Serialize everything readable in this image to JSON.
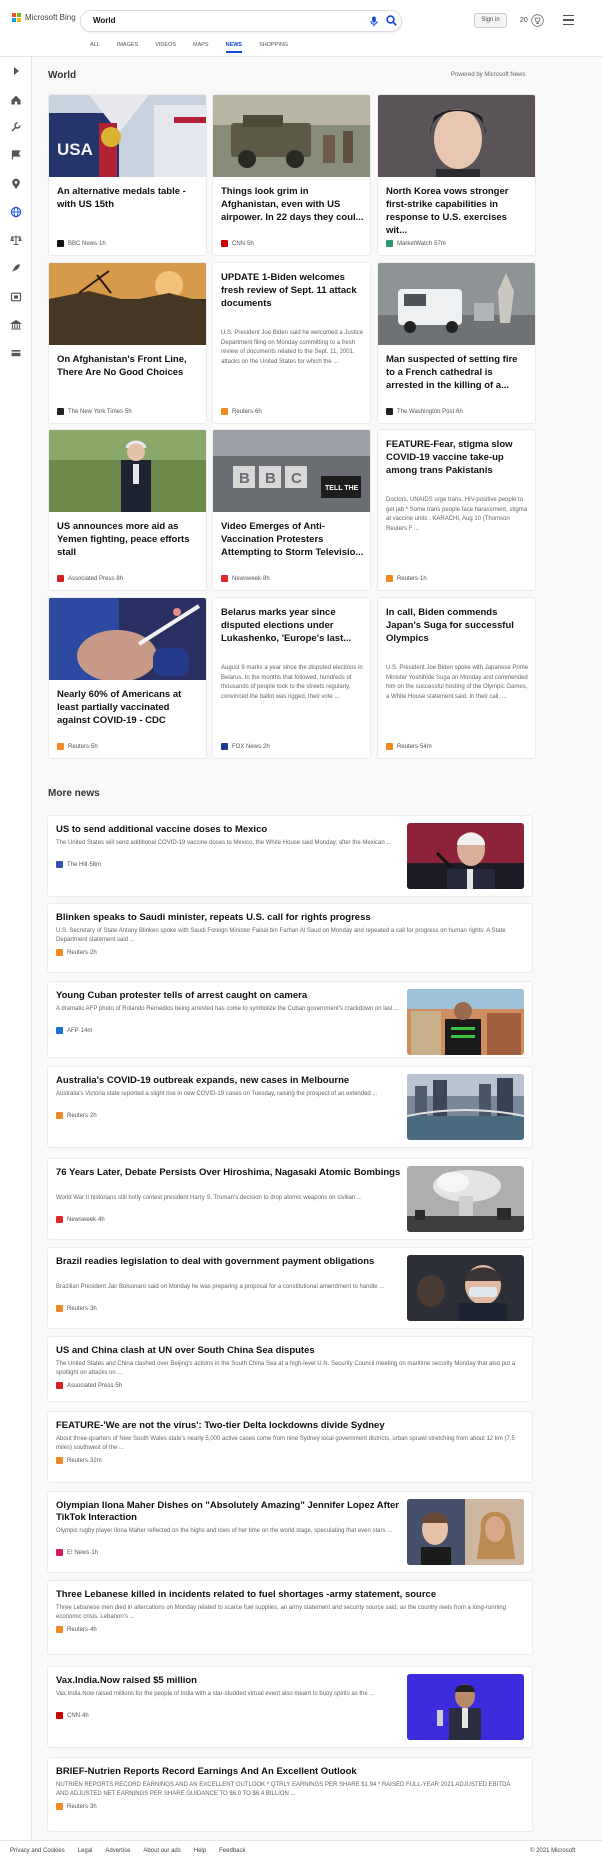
{
  "header": {
    "logo_text": "Microsoft Bing",
    "search_value": "World",
    "sign_in": "Sign in",
    "rewards_count": "20"
  },
  "tabs": [
    "ALL",
    "IMAGES",
    "VIDEOS",
    "MAPS",
    "NEWS",
    "SHOPPING"
  ],
  "active_tab": "NEWS",
  "section": {
    "title": "World",
    "powered": "Powered by Microsoft News"
  },
  "cards": [
    {
      "title": "An alternative medals table - with US 15th",
      "desc": "",
      "source": "BBC News",
      "time": "1h",
      "logo_color": "#111",
      "image": true,
      "img": "medal"
    },
    {
      "title": "Things look grim in Afghanistan, even with US airpower. In 22 days they coul...",
      "desc": "",
      "source": "CNN",
      "time": "5h",
      "logo_color": "#cc0000",
      "image": true,
      "img": "humvee"
    },
    {
      "title": "North Korea vows stronger first-strike capabilities in response to U.S. exercises wit...",
      "desc": "",
      "source": "MarketWatch",
      "time": "57m",
      "logo_color": "#2a9a6a",
      "image": true,
      "img": "woman"
    },
    {
      "title": "On Afghanistan's Front Line, There Are No Good Choices",
      "desc": "",
      "source": "The New York Times",
      "time": "5h",
      "logo_color": "#222",
      "image": true,
      "img": "front"
    },
    {
      "title": "UPDATE 1-Biden welcomes fresh review of Sept. 11 attack documents",
      "desc": "U.S. President Joe Biden said he welcomed a Justice Department filing on Monday committing to a fresh review of documents related to the Sept. 11, 2001, attacks on the United States for which the ...",
      "source": "Reuters",
      "time": "6h",
      "logo_color": "#f08a24",
      "image": false
    },
    {
      "title": "Man suspected of setting fire to a French cathedral is arrested in the killing of a...",
      "desc": "",
      "source": "The Washington Post",
      "time": "6h",
      "logo_color": "#222",
      "image": true,
      "img": "van"
    },
    {
      "title": "US announces more aid as Yemen fighting, peace efforts stall",
      "desc": "",
      "source": "Associated Press",
      "time": "8h",
      "logo_color": "#d42020",
      "image": true,
      "img": "biden"
    },
    {
      "title": "Video Emerges of Anti-Vaccination Protesters Attempting to Storm Televisio...",
      "desc": "",
      "source": "Newsweek",
      "time": "8h",
      "logo_color": "#e0262b",
      "image": true,
      "img": "bbc"
    },
    {
      "title": "FEATURE-Fear, stigma slow COVID-19 vaccine take-up among trans Pakistanis",
      "desc": "Doctors, UNAIDS urge trans, HIV-positive people to get jab * Some trans people face harassment, stigma at vaccine units . KARACHI, Aug 10 (Thomson Reuters F ...",
      "source": "Reuters",
      "time": "1h",
      "logo_color": "#f08a24",
      "image": false
    },
    {
      "title": "Nearly 60% of Americans at least partially vaccinated against COVID-19 - CDC",
      "desc": "",
      "source": "Reuters",
      "time": "5h",
      "logo_color": "#f08a24",
      "image": true,
      "img": "vaccine"
    },
    {
      "title": "Belarus marks year since disputed elections under Lukashenko, 'Europe's last...",
      "desc": "August 9 marks a year since the disputed elections in Belarus. In the months that followed, hundreds of thousands of people took to the streets regularly, convinced the ballot was rigged, their vote ...",
      "source": "FOX News",
      "time": "2h",
      "logo_color": "#1f3a8a",
      "image": false
    },
    {
      "title": "In call, Biden commends Japan's Suga for successful Olympics",
      "desc": "U.S. President Joe Biden spoke with Japanese Prime Minister Yoshihide Suga on Monday and commended him on the successful hosting of the Olympic Games, a White House statement said. In their call, ...",
      "source": "Reuters",
      "time": "54m",
      "logo_color": "#f08a24",
      "image": false
    }
  ],
  "more_title": "More news",
  "more_news": [
    {
      "title": "US to send additional vaccine doses to Mexico",
      "desc": "The United States will send additional COVID-19 vaccine doses to Mexico, the White House said Monday, after the Mexican ...",
      "source": "The Hill",
      "time": "58m",
      "logo_color": "#3355aa",
      "image": true,
      "img": "amlo"
    },
    {
      "title": "Blinken speaks to Saudi minister, repeats U.S. call for rights progress",
      "desc": "U.S. Secretary of State Antony Blinken spoke with Saudi Foreign Minister Faisal bin Farhan Al Saud on Monday and repeated a call for progress on human rights. A State Department statement said ...",
      "source": "Reuters",
      "time": "2h",
      "logo_color": "#f08a24",
      "image": false
    },
    {
      "title": "Young Cuban protester tells of arrest caught on camera",
      "desc": "A dramatic AFP photo of Rolando Remedios being arrested has come to symbolize the Cuban government's crackdown on last ...",
      "source": "AFP",
      "time": "14m",
      "logo_color": "#1f6fd1",
      "image": true,
      "img": "cuba"
    },
    {
      "title": "Australia's COVID-19 outbreak expands, new cases in Melbourne",
      "desc": "Australia's Victoria state reported a slight rise in new COVID-19 cases on Tuesday, raising the prospect of an extended ...",
      "source": "Reuters",
      "time": "2h",
      "logo_color": "#f08a24",
      "image": true,
      "img": "melb"
    },
    {
      "title": "76 Years Later, Debate Persists Over Hiroshima, Nagasaki Atomic Bombings",
      "desc": "World War II historians still hotly contest president Harry S. Truman's decision to drop atomic weapons on civilian ...",
      "source": "Newsweek",
      "time": "4h",
      "logo_color": "#e0262b",
      "image": true,
      "img": "bomb"
    },
    {
      "title": "Brazil readies legislation to deal with government payment obligations",
      "desc": "Brazilian President Jair Bolsonaro said on Monday he was preparing a proposal for a constitutional amendment to handle ...",
      "source": "Reuters",
      "time": "3h",
      "logo_color": "#f08a24",
      "image": true,
      "img": "bolso"
    },
    {
      "title": "US and China clash at UN over South China Sea disputes",
      "desc": "The United States and China clashed over Beijing's actions in the South China Sea at a high-level U.N. Security Council meeting on maritime security Monday that also put a spotlight on attacks on ...",
      "source": "Associated Press",
      "time": "5h",
      "logo_color": "#d42020",
      "image": false
    },
    {
      "title": "FEATURE-'We are not the virus': Two-tier Delta lockdowns divide Sydney",
      "desc": "About three-quarters of New South Wales state's nearly 5,000 active cases come from nine Sydney local government districts, urban sprawl stretching from about 12 km (7.5 miles) southwest of the ...",
      "source": "Reuters",
      "time": "32m",
      "logo_color": "#f08a24",
      "image": false
    },
    {
      "title": "Olympian Ilona Maher Dishes on \"Absolutely Amazing\" Jennifer Lopez After TikTok Interaction",
      "desc": "Olympic rugby player Ilona Maher reflected on the highs and lows of her time on the world stage, speculating that even stars ...",
      "source": "E! News",
      "time": "1h",
      "logo_color": "#d81b60",
      "image": true,
      "img": "jlo"
    },
    {
      "title": "Three Lebanese killed in incidents related to fuel shortages -army statement, source",
      "desc": "Three Lebanese men died in altercations on Monday related to scarce fuel supplies, an army statement and security source said, as the country reels from a long-running economic crisis. Lebanon's ...",
      "source": "Reuters",
      "time": "4h",
      "logo_color": "#f08a24",
      "image": false
    },
    {
      "title": "Vax.India.Now raised $5 million",
      "desc": "Vax.India.Now raised millions for the people of India with a star-studded virtual event also meant to buoy spirits as the ...",
      "source": "CNN",
      "time": "4h",
      "logo_color": "#cc0000",
      "image": true,
      "img": "vax"
    },
    {
      "title": "BRIEF-Nutrien Reports Record Earnings And An Excellent Outlook",
      "desc": "NUTRIEN REPORTS RECORD EARNINGS AND AN EXCELLENT OUTLOOK * QTRLY EARNINGS PER SHARE $1.94 * RAISED FULL-YEAR 2021 ADJUSTED EBITDA AND ADJUSTED NET EARNINGS PER SHARE GUIDANCE TO $6.0 TO $6.4 BILLION ...",
      "source": "Reuters",
      "time": "3h",
      "logo_color": "#f08a24",
      "image": false
    }
  ],
  "footer": {
    "links": [
      "Privacy and Cookies",
      "Legal",
      "Advertise",
      "About our ads",
      "Help",
      "Feedback"
    ],
    "copyright": "© 2021 Microsoft"
  },
  "rail_icons": [
    "expand-icon",
    "home-icon",
    "tools-icon",
    "flag-icon",
    "location-icon",
    "globe-icon",
    "scales-icon",
    "rocket-icon",
    "film-icon",
    "building-icon",
    "card-icon"
  ]
}
